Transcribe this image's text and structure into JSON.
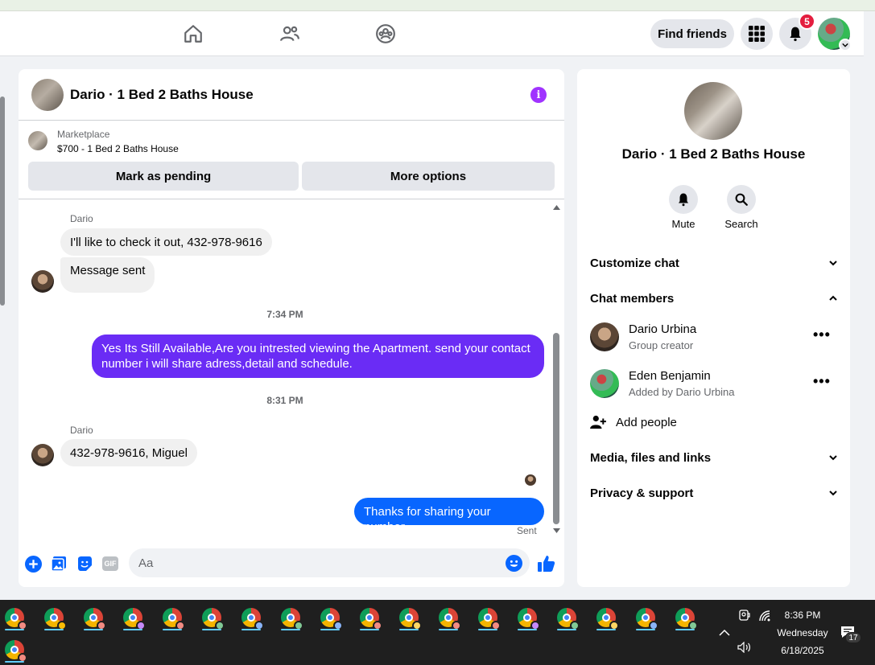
{
  "navbar": {
    "find_friends_label": "Find friends",
    "notification_count": "5",
    "icons": [
      "home-icon",
      "friends-icon",
      "groups-icon",
      "menu-grid-icon",
      "bell-icon"
    ]
  },
  "chat": {
    "title": "Dario · 1 Bed 2 Baths House",
    "marketplace_label": "Marketplace",
    "listing": "$700 - 1 Bed 2 Baths House",
    "mark_pending_label": "Mark as pending",
    "more_options_label": "More options",
    "messages": [
      {
        "sender": "Dario",
        "text": "I'll like to check it out, 432-978-9616"
      },
      {
        "text": "Message sent"
      },
      {
        "time": "7:34 PM"
      },
      {
        "text": "Yes Its Still Available,Are you intrested viewing the Apartment. send your contact number i will share adress,detail and schedule."
      },
      {
        "time": "8:31 PM"
      },
      {
        "sender": "Dario",
        "text": "432-978-9616, Miguel"
      },
      {
        "text": "Thanks for sharing your number"
      }
    ],
    "sent_status": "Sent",
    "composer_placeholder": "Aa",
    "gif_label": "GIF"
  },
  "info": {
    "title": "Dario · 1 Bed 2 Baths House",
    "mute_label": "Mute",
    "search_label": "Search",
    "customize_chat": "Customize chat",
    "chat_members": "Chat members",
    "members": [
      {
        "name": "Dario Urbina",
        "role": "Group creator"
      },
      {
        "name": "Eden Benjamin",
        "role": "Added by Dario Urbina"
      }
    ],
    "add_people": "Add people",
    "media_files_links": "Media, files and links",
    "privacy_support": "Privacy & support"
  },
  "colors": {
    "accent": "#0866ff",
    "outgoing_purple": "#6a2cf5",
    "outgoing_blue": "#0866ff",
    "badge_red": "#e41e3f",
    "info_purple": "#a033ff"
  },
  "taskbar": {
    "time": "8:36 PM",
    "day": "Wednesday",
    "date": "6/18/2025",
    "notification_count": "17",
    "chrome_profile_colors": [
      "#f28b82",
      "#fbbc04",
      "#f28b82",
      "#c58af9",
      "#f28b82",
      "#81c995",
      "#8ab4f8",
      "#81c995",
      "#8ab4f8",
      "#f28b82",
      "#fdd663",
      "#f28b82",
      "#f28b82",
      "#c58af9",
      "#81c995",
      "#fdd663",
      "#8ab4f8",
      "#81c995",
      "#f28b82"
    ]
  }
}
